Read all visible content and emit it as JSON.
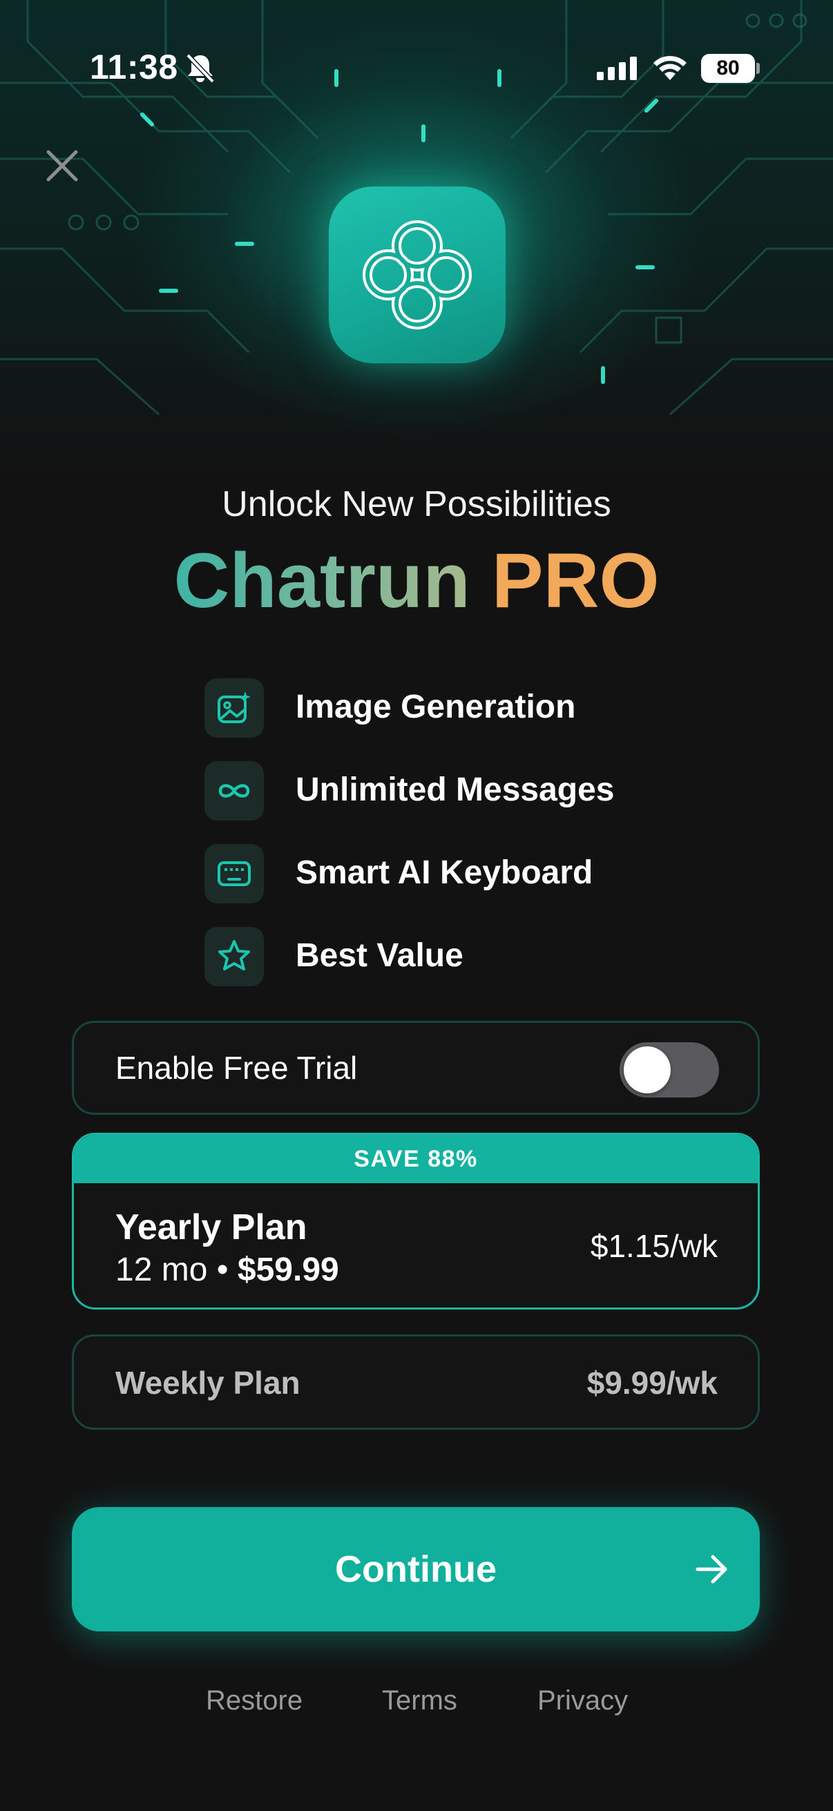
{
  "status_bar": {
    "time": "11:38",
    "battery": "80"
  },
  "hero": {
    "subtitle": "Unlock New Possibilities",
    "title_brand": "Chatrun",
    "title_pro": "PRO"
  },
  "features": [
    {
      "label": "Image Generation",
      "icon": "image-sparkle-icon"
    },
    {
      "label": "Unlimited Messages",
      "icon": "infinity-icon"
    },
    {
      "label": "Smart AI Keyboard",
      "icon": "keyboard-icon"
    },
    {
      "label": "Best Value",
      "icon": "star-icon"
    }
  ],
  "trial": {
    "label": "Enable Free Trial",
    "enabled": false
  },
  "plans": {
    "yearly": {
      "badge": "SAVE 88%",
      "name": "Yearly Plan",
      "term": "12 mo",
      "separator": "•",
      "price": "$59.99",
      "per_week": "$1.15/wk"
    },
    "weekly": {
      "name": "Weekly Plan",
      "price": "$9.99/wk"
    }
  },
  "continue_label": "Continue",
  "footer": {
    "restore": "Restore",
    "terms": "Terms",
    "privacy": "Privacy"
  },
  "colors": {
    "accent": "#10b09d",
    "pro": "#f2a95a",
    "background": "#121212"
  }
}
